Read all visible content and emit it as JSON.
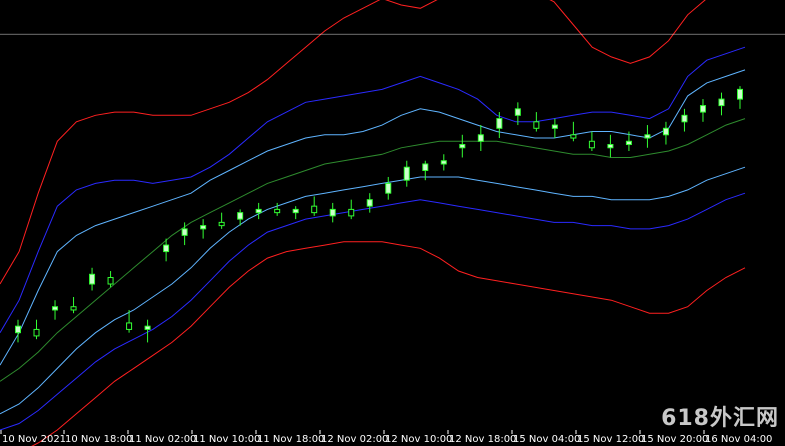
{
  "chart_data": {
    "type": "candlestick",
    "title": "",
    "x_tick_labels": [
      "10 Nov 2021",
      "10 Nov 18:00",
      "11 Nov 02:00",
      "11 Nov 10:00",
      "11 Nov 18:00",
      "12 Nov 02:00",
      "12 Nov 10:00",
      "12 Nov 18:00",
      "15 Nov 04:00",
      "15 Nov 12:00",
      "15 Nov 20:00",
      "16 Nov 04:00"
    ],
    "grid": false,
    "colors": {
      "background": "#000000",
      "bull_candle": "#ccffcc",
      "bear_candle": "#000000",
      "wick": "#33ff33",
      "outer_band": "#ff2020",
      "middle_band": "#2a2aff",
      "inner_band": "#5fb4ff",
      "center_line": "#2e8b2e",
      "reference_line": "#ffffff"
    },
    "reference_line_level": 0.97,
    "series": [
      {
        "kind": "band",
        "role": "outer-upper",
        "values": [
          0.2,
          0.3,
          0.48,
          0.64,
          0.7,
          0.72,
          0.73,
          0.73,
          0.72,
          0.72,
          0.72,
          0.74,
          0.76,
          0.79,
          0.83,
          0.88,
          0.93,
          0.98,
          1.02,
          1.05,
          1.08,
          1.06,
          1.05,
          1.08,
          1.1,
          1.12,
          1.13,
          1.12,
          1.1,
          1.07,
          1.0,
          0.93,
          0.9,
          0.88,
          0.9,
          0.95,
          1.03,
          1.08,
          1.1,
          1.12
        ]
      },
      {
        "kind": "band",
        "role": "middle-upper",
        "values": [
          0.05,
          0.15,
          0.3,
          0.44,
          0.49,
          0.51,
          0.52,
          0.52,
          0.51,
          0.52,
          0.53,
          0.56,
          0.6,
          0.65,
          0.7,
          0.73,
          0.76,
          0.77,
          0.78,
          0.79,
          0.8,
          0.82,
          0.84,
          0.82,
          0.8,
          0.77,
          0.72,
          0.7,
          0.7,
          0.71,
          0.72,
          0.73,
          0.73,
          0.72,
          0.71,
          0.74,
          0.84,
          0.89,
          0.91,
          0.93
        ]
      },
      {
        "kind": "band",
        "role": "inner-upper",
        "values": [
          -0.05,
          0.05,
          0.18,
          0.3,
          0.35,
          0.38,
          0.4,
          0.42,
          0.44,
          0.46,
          0.48,
          0.52,
          0.55,
          0.58,
          0.61,
          0.63,
          0.65,
          0.66,
          0.66,
          0.67,
          0.69,
          0.72,
          0.74,
          0.73,
          0.71,
          0.69,
          0.67,
          0.66,
          0.65,
          0.65,
          0.66,
          0.67,
          0.67,
          0.66,
          0.65,
          0.68,
          0.78,
          0.82,
          0.84,
          0.86
        ]
      },
      {
        "kind": "band",
        "role": "center",
        "values": [
          -0.1,
          -0.06,
          -0.01,
          0.05,
          0.1,
          0.15,
          0.2,
          0.25,
          0.3,
          0.35,
          0.39,
          0.42,
          0.45,
          0.48,
          0.51,
          0.53,
          0.55,
          0.57,
          0.58,
          0.59,
          0.6,
          0.62,
          0.63,
          0.64,
          0.64,
          0.64,
          0.64,
          0.63,
          0.62,
          0.61,
          0.6,
          0.6,
          0.59,
          0.59,
          0.6,
          0.61,
          0.63,
          0.66,
          0.69,
          0.71
        ]
      },
      {
        "kind": "band",
        "role": "inner-lower",
        "values": [
          -0.2,
          -0.17,
          -0.12,
          -0.06,
          0.0,
          0.05,
          0.09,
          0.12,
          0.16,
          0.2,
          0.25,
          0.31,
          0.36,
          0.4,
          0.43,
          0.45,
          0.47,
          0.48,
          0.49,
          0.5,
          0.51,
          0.52,
          0.53,
          0.53,
          0.53,
          0.52,
          0.51,
          0.5,
          0.49,
          0.48,
          0.47,
          0.47,
          0.46,
          0.46,
          0.46,
          0.47,
          0.49,
          0.52,
          0.54,
          0.56
        ]
      },
      {
        "kind": "band",
        "role": "middle-lower",
        "values": [
          -0.25,
          -0.23,
          -0.19,
          -0.14,
          -0.09,
          -0.04,
          0.0,
          0.03,
          0.06,
          0.1,
          0.15,
          0.21,
          0.27,
          0.32,
          0.36,
          0.38,
          0.4,
          0.41,
          0.42,
          0.43,
          0.44,
          0.45,
          0.46,
          0.45,
          0.44,
          0.43,
          0.42,
          0.41,
          0.4,
          0.39,
          0.39,
          0.38,
          0.38,
          0.37,
          0.37,
          0.38,
          0.4,
          0.43,
          0.46,
          0.48
        ]
      },
      {
        "kind": "band",
        "role": "outer-lower",
        "values": [
          -0.34,
          -0.32,
          -0.29,
          -0.25,
          -0.2,
          -0.15,
          -0.1,
          -0.06,
          -0.02,
          0.02,
          0.07,
          0.13,
          0.19,
          0.24,
          0.28,
          0.3,
          0.31,
          0.32,
          0.33,
          0.33,
          0.33,
          0.32,
          0.31,
          0.28,
          0.24,
          0.22,
          0.21,
          0.2,
          0.19,
          0.18,
          0.17,
          0.16,
          0.15,
          0.13,
          0.11,
          0.11,
          0.13,
          0.18,
          0.22,
          0.25
        ]
      },
      {
        "kind": "candles",
        "ohlc": [
          [
            0.05,
            0.09,
            0.02,
            0.07
          ],
          [
            0.06,
            0.09,
            0.03,
            0.04
          ],
          [
            0.12,
            0.15,
            0.09,
            0.13
          ],
          [
            0.13,
            0.16,
            0.11,
            0.12
          ],
          [
            0.2,
            0.25,
            0.18,
            0.23
          ],
          [
            0.22,
            0.24,
            0.19,
            0.2
          ],
          [
            0.08,
            0.12,
            0.05,
            0.06
          ],
          [
            0.06,
            0.09,
            0.02,
            0.07
          ],
          [
            0.3,
            0.34,
            0.27,
            0.32
          ],
          [
            0.35,
            0.39,
            0.32,
            0.37
          ],
          [
            0.37,
            0.4,
            0.34,
            0.38
          ],
          [
            0.39,
            0.42,
            0.37,
            0.38
          ],
          [
            0.4,
            0.43,
            0.38,
            0.42
          ],
          [
            0.42,
            0.45,
            0.4,
            0.43
          ],
          [
            0.43,
            0.45,
            0.41,
            0.42
          ],
          [
            0.42,
            0.44,
            0.4,
            0.43
          ],
          [
            0.44,
            0.47,
            0.41,
            0.42
          ],
          [
            0.41,
            0.45,
            0.39,
            0.43
          ],
          [
            0.43,
            0.46,
            0.4,
            0.41
          ],
          [
            0.44,
            0.48,
            0.42,
            0.46
          ],
          [
            0.48,
            0.53,
            0.46,
            0.51
          ],
          [
            0.52,
            0.58,
            0.5,
            0.56
          ],
          [
            0.55,
            0.58,
            0.52,
            0.57
          ],
          [
            0.57,
            0.6,
            0.55,
            0.58
          ],
          [
            0.62,
            0.66,
            0.59,
            0.63
          ],
          [
            0.64,
            0.69,
            0.61,
            0.66
          ],
          [
            0.68,
            0.73,
            0.65,
            0.71
          ],
          [
            0.72,
            0.76,
            0.69,
            0.74
          ],
          [
            0.7,
            0.73,
            0.67,
            0.68
          ],
          [
            0.68,
            0.71,
            0.65,
            0.69
          ],
          [
            0.66,
            0.7,
            0.64,
            0.65
          ],
          [
            0.64,
            0.67,
            0.61,
            0.62
          ],
          [
            0.62,
            0.66,
            0.59,
            0.63
          ],
          [
            0.63,
            0.67,
            0.61,
            0.64
          ],
          [
            0.65,
            0.69,
            0.62,
            0.66
          ],
          [
            0.66,
            0.7,
            0.63,
            0.68
          ],
          [
            0.7,
            0.74,
            0.67,
            0.72
          ],
          [
            0.73,
            0.77,
            0.7,
            0.75
          ],
          [
            0.75,
            0.79,
            0.72,
            0.77
          ],
          [
            0.77,
            0.81,
            0.74,
            0.8
          ]
        ]
      }
    ]
  },
  "watermark": {
    "text": "618外汇网"
  }
}
